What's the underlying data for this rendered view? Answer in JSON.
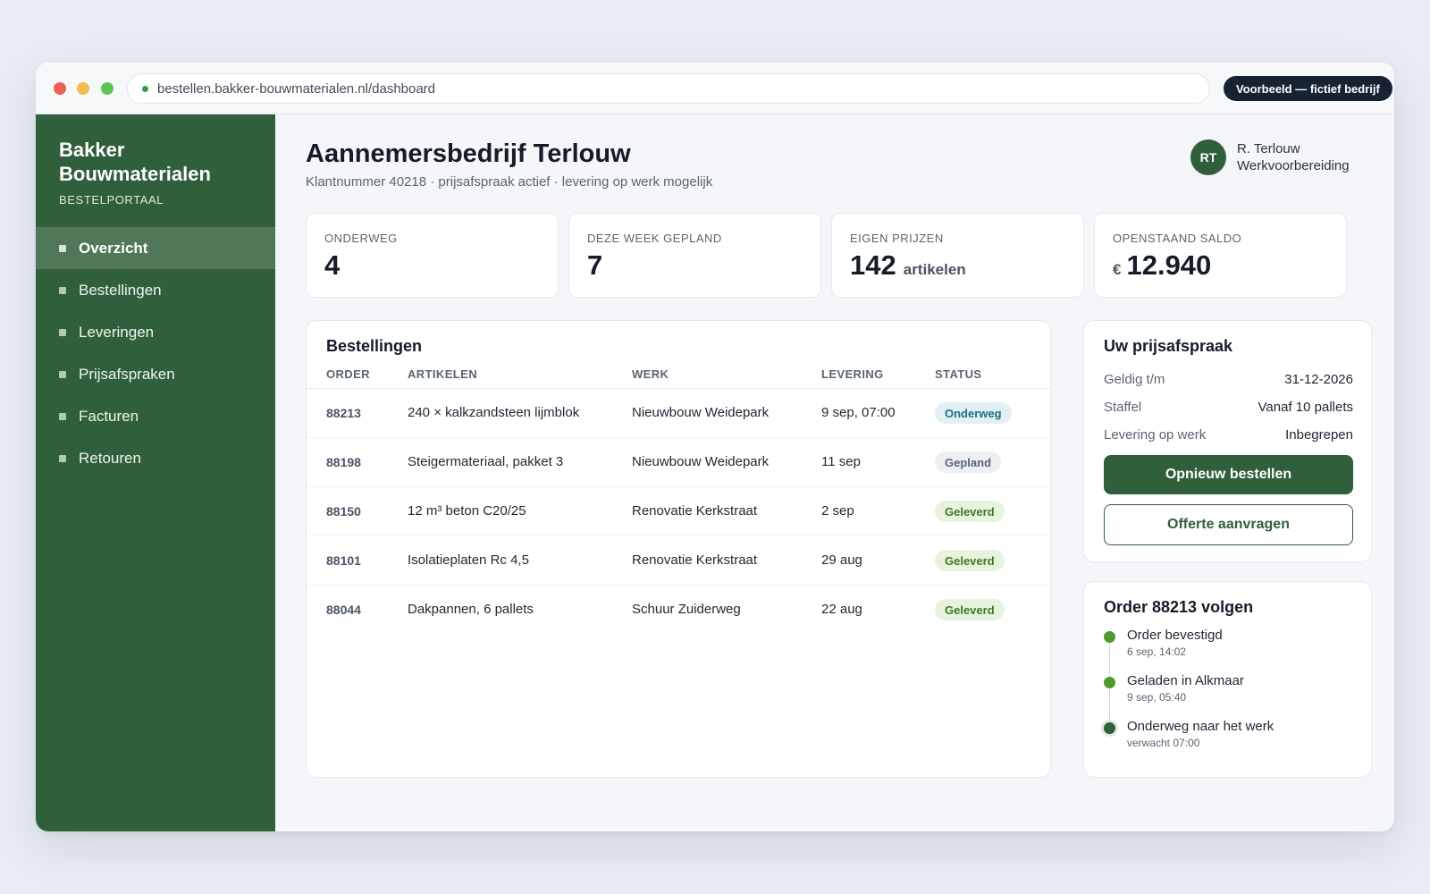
{
  "browser": {
    "url": "bestellen.bakker-bouwmaterialen.nl/dashboard",
    "badge": "Voorbeeld — fictief bedrijf"
  },
  "sidebar": {
    "brand_name": "Bakker Bouwmaterialen",
    "brand_sub": "BESTELPORTAAL",
    "items": [
      {
        "label": "Overzicht",
        "active": true
      },
      {
        "label": "Bestellingen"
      },
      {
        "label": "Leveringen"
      },
      {
        "label": "Prijsafspraken"
      },
      {
        "label": "Facturen"
      },
      {
        "label": "Retouren"
      }
    ]
  },
  "header": {
    "title": "Aannemersbedrijf Terlouw",
    "subtitle": "Klantnummer 40218 · prijsafspraak actief · levering op werk mogelijk",
    "user_initials": "RT",
    "user_name": "R. Terlouw",
    "user_role": "Werkvoorbereiding"
  },
  "stats": [
    {
      "label": "ONDERWEG",
      "value": "4"
    },
    {
      "label": "DEZE WEEK GEPLAND",
      "value": "7"
    },
    {
      "label": "EIGEN PRIJZEN",
      "value": "142",
      "unit": "artikelen"
    },
    {
      "label": "OPENSTAAND SALDO",
      "prefix": "€",
      "value": "12.940"
    }
  ],
  "orders": {
    "title": "Bestellingen",
    "columns": [
      "ORDER",
      "ARTIKELEN",
      "WERK",
      "LEVERING",
      "STATUS"
    ],
    "rows": [
      {
        "order": "88213",
        "artikelen": "240 × kalkzandsteen lijmblok",
        "werk": "Nieuwbouw Weidepark",
        "levering": "9 sep, 07:00",
        "status": "Onderweg"
      },
      {
        "order": "88198",
        "artikelen": "Steigermateriaal, pakket 3",
        "werk": "Nieuwbouw Weidepark",
        "levering": "11 sep",
        "status": "Gepland"
      },
      {
        "order": "88150",
        "artikelen": "12 m³ beton C20/25",
        "werk": "Renovatie Kerkstraat",
        "levering": "2 sep",
        "status": "Geleverd"
      },
      {
        "order": "88101",
        "artikelen": "Isolatieplaten Rc 4,5",
        "werk": "Renovatie Kerkstraat",
        "levering": "29 aug",
        "status": "Geleverd"
      },
      {
        "order": "88044",
        "artikelen": "Dakpannen, 6 pallets",
        "werk": "Schuur Zuiderweg",
        "levering": "22 aug",
        "status": "Geleverd"
      }
    ]
  },
  "pricing": {
    "title": "Uw prijsafspraak",
    "rows": [
      {
        "key": "Geldig t/m",
        "value": "31-12-2026"
      },
      {
        "key": "Staffel",
        "value": "Vanaf 10 pallets"
      },
      {
        "key": "Levering op werk",
        "value": "Inbegrepen"
      }
    ],
    "primary_button": "Opnieuw bestellen",
    "secondary_button": "Offerte aanvragen"
  },
  "tracking": {
    "title": "Order 88213 volgen",
    "steps": [
      {
        "title": "Order bevestigd",
        "time": "6 sep, 14:02"
      },
      {
        "title": "Geladen in Alkmaar",
        "time": "9 sep, 05:40"
      },
      {
        "title": "Onderweg naar het werk",
        "time": "verwacht 07:00"
      }
    ]
  },
  "colors": {
    "brand_green": "#2f5f3b",
    "status_onderweg": "#1c6f82",
    "status_gepland": "#5b6472",
    "status_geleverd": "#3d7a26"
  }
}
